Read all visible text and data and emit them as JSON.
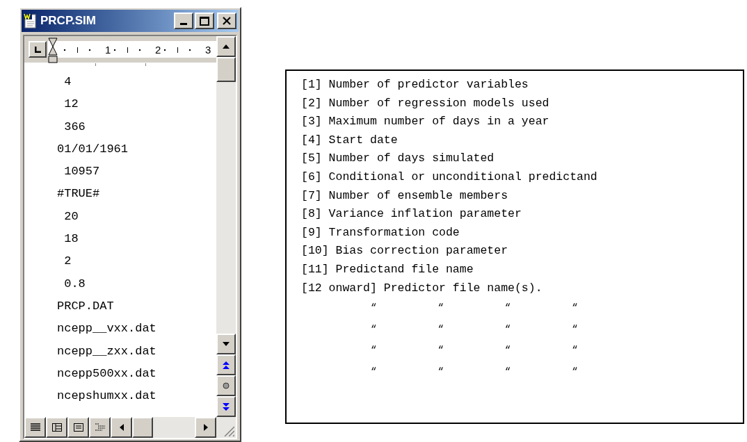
{
  "window": {
    "title": "PRCP.SIM"
  },
  "ruler": {
    "labels": [
      "1",
      "2",
      "3"
    ]
  },
  "document": {
    "lines": [
      " 4",
      " 12",
      " 366",
      "01/01/1961",
      " 10957",
      "#TRUE#",
      " 20",
      " 18",
      " 2",
      " 0.8",
      "PRCP.DAT",
      "ncepp__vxx.dat",
      "ncepp__zxx.dat",
      "ncepp500xx.dat",
      "ncepshumxx.dat"
    ]
  },
  "legend": {
    "lines": [
      "[1] Number of predictor variables",
      "[2] Number of regression models used",
      "[3] Maximum number of days in a year",
      "[4] Start date",
      "[5] Number of days simulated",
      "[6] Conditional or unconditional predictand",
      "[7] Number of ensemble members",
      "[8] Variance inflation parameter",
      "[9] Transformation code",
      "[10] Bias correction parameter",
      "[11] Predictand file name",
      "[12 onward] Predictor file name(s)."
    ],
    "ditto_rows": [
      [
        "“",
        "“",
        "“",
        "“"
      ],
      [
        "“",
        "“",
        "“",
        "“"
      ],
      [
        "“",
        "“",
        "“",
        "“"
      ],
      [
        "“",
        "“",
        "“",
        "“"
      ]
    ]
  }
}
